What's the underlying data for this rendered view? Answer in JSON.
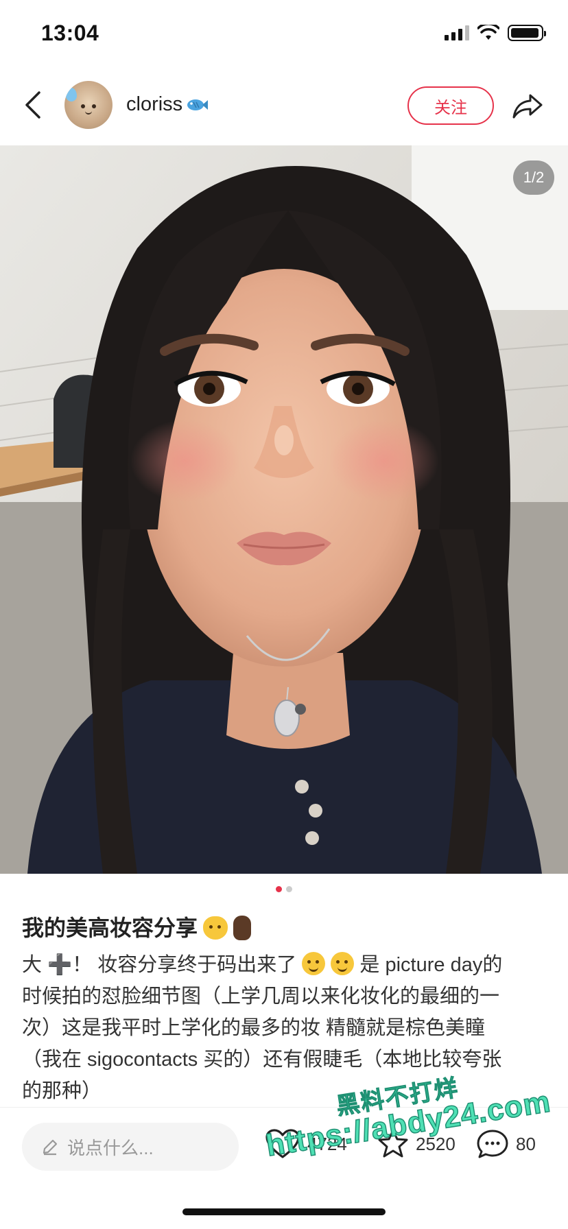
{
  "status_bar": {
    "time": "13:04",
    "battery_level": 0.95
  },
  "header": {
    "back_icon": "chevron-left-icon",
    "avatar_icon": "avatar-sweat-drop",
    "username": "cloriss",
    "username_emoji": "fish-icon",
    "follow_label": "关注",
    "share_icon": "share-icon"
  },
  "photo": {
    "page_indicator": "1/2",
    "current_page": 1,
    "total_pages": 2
  },
  "post": {
    "title": "我的美高妆容分享",
    "title_emojis": [
      "smiling-cat-icon",
      "crossed-fingers-icon"
    ],
    "body_lines": [
      "大 ➕！ 妆容分享终于码出来了",
      "是 picture day的",
      "时候拍的怼脸细节图（上学几周以来化妆化的最细的一",
      "次）这是我平时上学化的最多的妆 精髓就是棕色美瞳",
      "（我在 sigocontacts 买的）还有假睫毛（本地比较夸张",
      "的那种）"
    ]
  },
  "bottom_bar": {
    "comment_placeholder": "说点什么...",
    "like_count": "4724",
    "collect_count": "2520",
    "comment_count": "80"
  },
  "watermark": {
    "line1": "黑料不打烊",
    "line2": "https://abdy24.com"
  },
  "colors": {
    "accent": "#e6324a",
    "watermark": "#4fe0b4"
  }
}
